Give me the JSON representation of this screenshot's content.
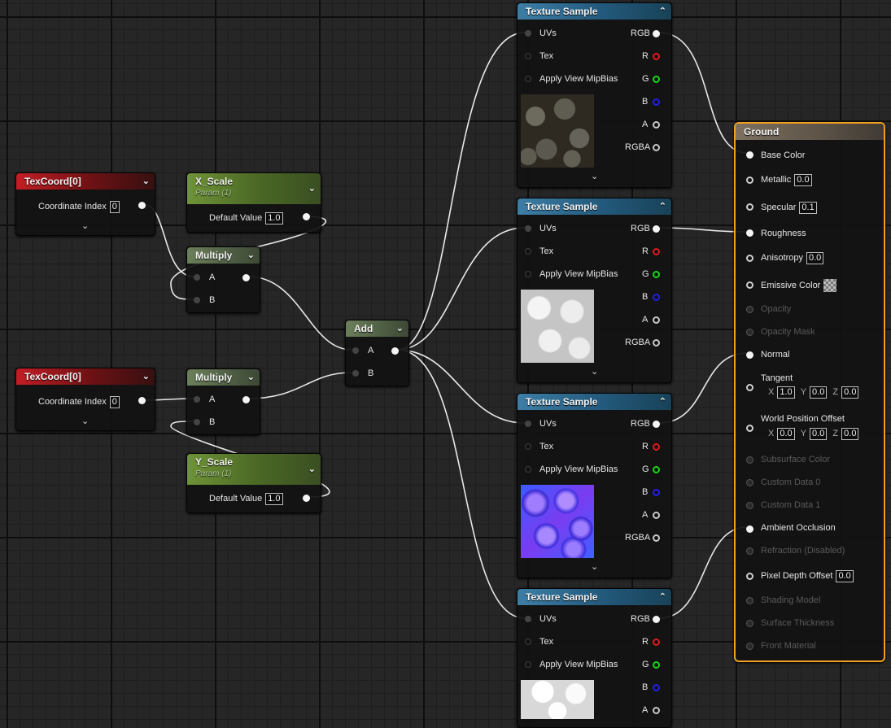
{
  "texcoord1": {
    "title": "TexCoord[0]",
    "label": "Coordinate Index",
    "value": "0"
  },
  "texcoord2": {
    "title": "TexCoord[0]",
    "label": "Coordinate Index",
    "value": "0"
  },
  "xscale": {
    "title": "X_Scale",
    "subtitle": "Param (1)",
    "label": "Default Value",
    "value": "1.0"
  },
  "yscale": {
    "title": "Y_Scale",
    "subtitle": "Param (1)",
    "label": "Default Value",
    "value": "1.0"
  },
  "multiply1": {
    "title": "Multiply",
    "a": "A",
    "b": "B"
  },
  "multiply2": {
    "title": "Multiply",
    "a": "A",
    "b": "B"
  },
  "add": {
    "title": "Add",
    "a": "A",
    "b": "B"
  },
  "tex_pins": {
    "uvs": "UVs",
    "tex": "Tex",
    "mip": "Apply View MipBias",
    "rgb": "RGB",
    "r": "R",
    "g": "G",
    "b": "B",
    "a": "A",
    "rgba": "RGBA"
  },
  "textures": [
    {
      "title": "Texture Sample",
      "thumb": "dirt"
    },
    {
      "title": "Texture Sample",
      "thumb": "rough"
    },
    {
      "title": "Texture Sample",
      "thumb": "normal"
    },
    {
      "title": "Texture Sample",
      "thumb": "white"
    }
  ],
  "material": {
    "title": "Ground",
    "base_color": "Base Color",
    "metallic": "Metallic",
    "metallic_value": "0.0",
    "specular": "Specular",
    "specular_value": "0.1",
    "roughness": "Roughness",
    "anisotropy": "Anisotropy",
    "anisotropy_value": "0.0",
    "emissive": "Emissive Color",
    "opacity": "Opacity",
    "opacity_mask": "Opacity Mask",
    "normal": "Normal",
    "tangent": "Tangent",
    "tangent_x": "1.0",
    "tangent_y": "0.0",
    "tangent_z": "0.0",
    "wpo": "World Position Offset",
    "wpo_x": "0.0",
    "wpo_y": "0.0",
    "wpo_z": "0.0",
    "subsurface": "Subsurface Color",
    "custom0": "Custom Data 0",
    "custom1": "Custom Data 1",
    "ao": "Ambient Occlusion",
    "refraction": "Refraction (Disabled)",
    "pdo": "Pixel Depth Offset",
    "pdo_value": "0.0",
    "shading_model": "Shading Model",
    "surface_thickness": "Surface Thickness",
    "front_material": "Front Material",
    "x": "X",
    "y": "Y",
    "z": "Z"
  },
  "icons": {
    "collapse": "chevron-down-icon",
    "expand": "chevron-up-icon"
  }
}
